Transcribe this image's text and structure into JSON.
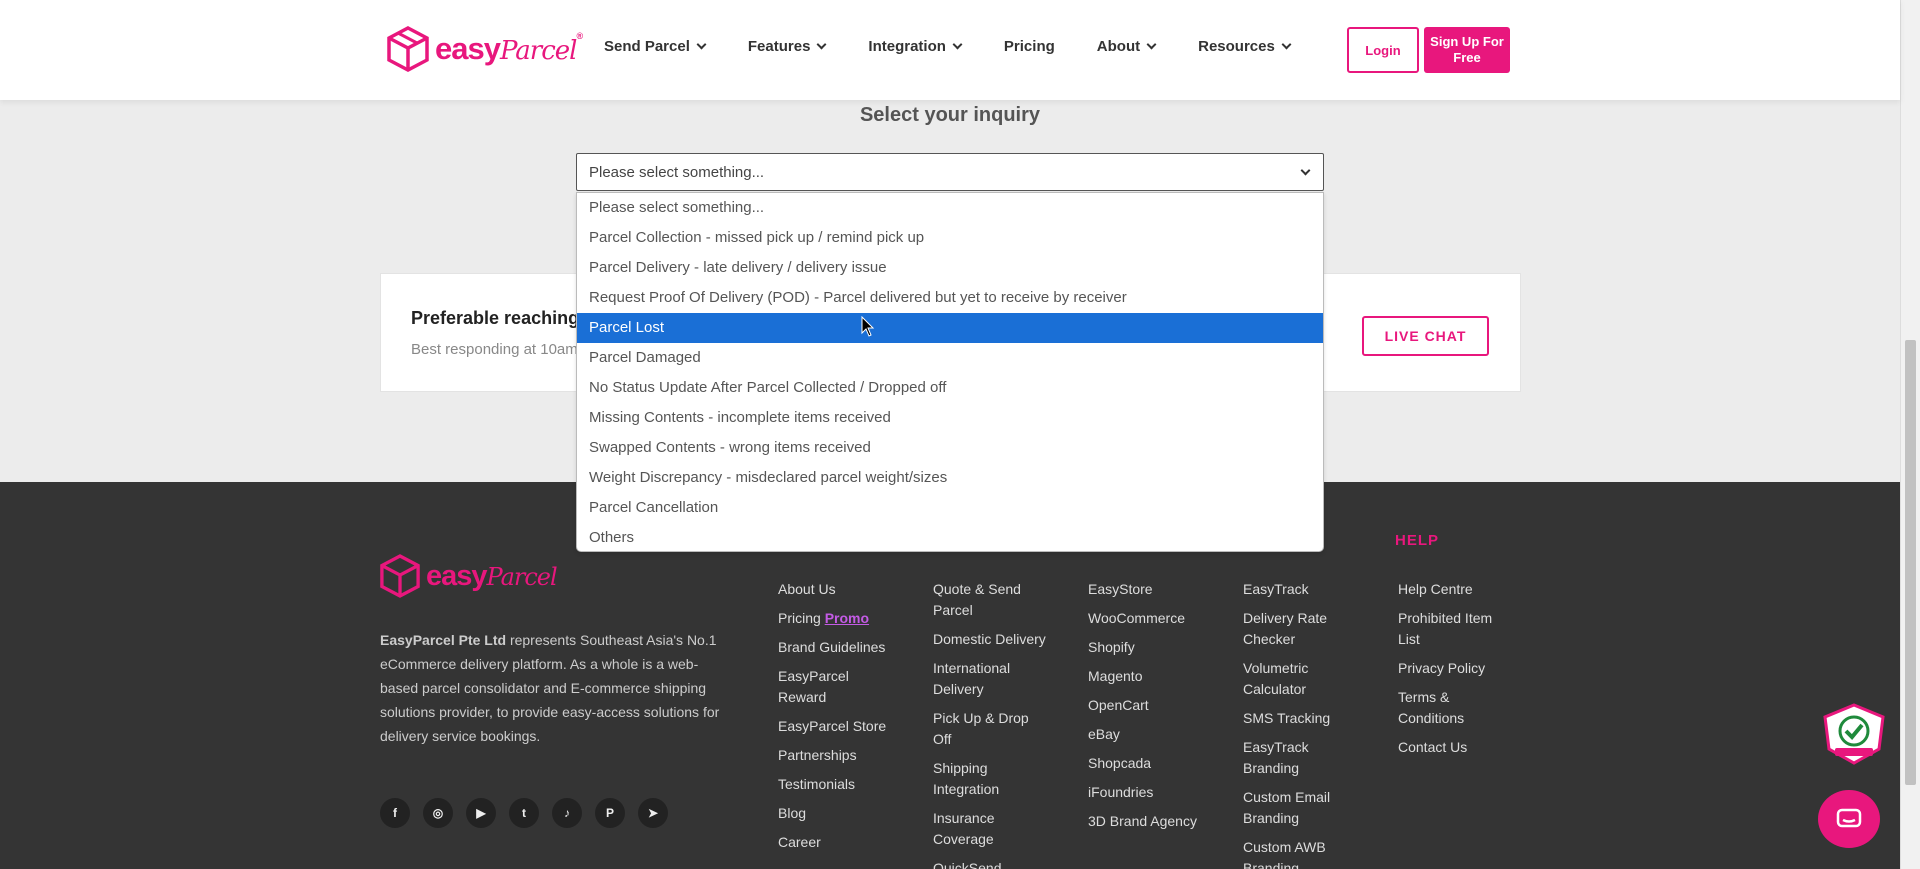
{
  "header": {
    "brand": "easy",
    "brand_script": "Parcel",
    "nav": [
      "Send Parcel",
      "Features",
      "Integration",
      "Pricing",
      "About",
      "Resources"
    ],
    "login": "Login",
    "signup": "Sign Up For Free"
  },
  "inquiry": {
    "title": "Select your inquiry",
    "selected_value": "Please select something...",
    "options": [
      "Please select something...",
      "Parcel Collection - missed pick up / remind pick up",
      "Parcel Delivery - late delivery / delivery issue",
      "Request Proof Of Delivery (POD) - Parcel delivered but yet to receive by receiver",
      "Parcel Lost",
      "Parcel Damaged",
      "No Status Update After Parcel Collected / Dropped off",
      "Missing Contents - incomplete items received",
      "Swapped Contents - wrong items received",
      "Weight Discrepancy - misdeclared parcel weight/sizes",
      "Parcel Cancellation",
      "Others"
    ],
    "highlighted_option": "Parcel Lost"
  },
  "contact": {
    "title": "Preferable reaching t",
    "subtitle": "Best responding at 10am",
    "live_chat": "LIVE CHAT"
  },
  "footer": {
    "company": "EasyParcel Pte Ltd",
    "about_rest": " represents Southeast Asia's No.1 eCommerce delivery platform. As a whole is a web-based parcel consolidator and E-commerce shipping solutions provider, to provide easy-access solutions for delivery service bookings.",
    "col1": [
      "About Us",
      "Pricing",
      "Brand Guidelines",
      "EasyParcel Reward",
      "EasyParcel Store",
      "Partnerships",
      "Testimonials",
      "Blog",
      "Career"
    ],
    "promo": "Promo",
    "col2": [
      "Quote & Send Parcel",
      "Domestic Delivery",
      "International Delivery",
      "Pick Up & Drop Off",
      "Shipping Integration",
      "Insurance Coverage",
      "QuickSend"
    ],
    "col3": [
      "EasyStore",
      "WooCommerce",
      "Shopify",
      "Magento",
      "OpenCart",
      "eBay",
      "Shopcada",
      "iFoundries",
      "3D Brand Agency"
    ],
    "col4": [
      "EasyTrack",
      "Delivery Rate Checker",
      "Volumetric Calculator",
      "SMS Tracking",
      "EasyTrack Branding",
      "Custom Email Branding",
      "Custom AWB Branding"
    ],
    "help_title": "HELP",
    "col5": [
      "Help Centre",
      "Prohibited Item List",
      "Privacy Policy",
      "Terms & Conditions",
      "Contact Us"
    ],
    "socials": [
      "facebook-icon",
      "instagram-icon",
      "youtube-icon",
      "twitter-icon",
      "tiktok-icon",
      "pinterest-icon",
      "telegram-icon"
    ]
  },
  "colors": {
    "brand": "#e8177d",
    "highlight": "#1a6fd6",
    "footer_bg": "#343434"
  }
}
